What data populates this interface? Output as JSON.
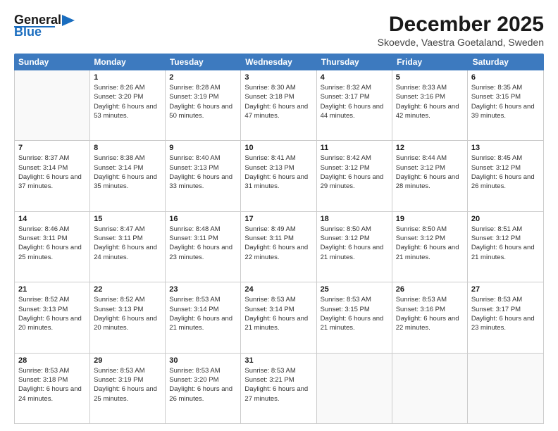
{
  "logo": {
    "line1": "General",
    "line2": "Blue"
  },
  "title": "December 2025",
  "subtitle": "Skoevde, Vaestra Goetaland, Sweden",
  "headers": [
    "Sunday",
    "Monday",
    "Tuesday",
    "Wednesday",
    "Thursday",
    "Friday",
    "Saturday"
  ],
  "weeks": [
    [
      {
        "day": "",
        "sunrise": "",
        "sunset": "",
        "daylight": ""
      },
      {
        "day": "1",
        "sunrise": "Sunrise: 8:26 AM",
        "sunset": "Sunset: 3:20 PM",
        "daylight": "Daylight: 6 hours and 53 minutes."
      },
      {
        "day": "2",
        "sunrise": "Sunrise: 8:28 AM",
        "sunset": "Sunset: 3:19 PM",
        "daylight": "Daylight: 6 hours and 50 minutes."
      },
      {
        "day": "3",
        "sunrise": "Sunrise: 8:30 AM",
        "sunset": "Sunset: 3:18 PM",
        "daylight": "Daylight: 6 hours and 47 minutes."
      },
      {
        "day": "4",
        "sunrise": "Sunrise: 8:32 AM",
        "sunset": "Sunset: 3:17 PM",
        "daylight": "Daylight: 6 hours and 44 minutes."
      },
      {
        "day": "5",
        "sunrise": "Sunrise: 8:33 AM",
        "sunset": "Sunset: 3:16 PM",
        "daylight": "Daylight: 6 hours and 42 minutes."
      },
      {
        "day": "6",
        "sunrise": "Sunrise: 8:35 AM",
        "sunset": "Sunset: 3:15 PM",
        "daylight": "Daylight: 6 hours and 39 minutes."
      }
    ],
    [
      {
        "day": "7",
        "sunrise": "Sunrise: 8:37 AM",
        "sunset": "Sunset: 3:14 PM",
        "daylight": "Daylight: 6 hours and 37 minutes."
      },
      {
        "day": "8",
        "sunrise": "Sunrise: 8:38 AM",
        "sunset": "Sunset: 3:14 PM",
        "daylight": "Daylight: 6 hours and 35 minutes."
      },
      {
        "day": "9",
        "sunrise": "Sunrise: 8:40 AM",
        "sunset": "Sunset: 3:13 PM",
        "daylight": "Daylight: 6 hours and 33 minutes."
      },
      {
        "day": "10",
        "sunrise": "Sunrise: 8:41 AM",
        "sunset": "Sunset: 3:13 PM",
        "daylight": "Daylight: 6 hours and 31 minutes."
      },
      {
        "day": "11",
        "sunrise": "Sunrise: 8:42 AM",
        "sunset": "Sunset: 3:12 PM",
        "daylight": "Daylight: 6 hours and 29 minutes."
      },
      {
        "day": "12",
        "sunrise": "Sunrise: 8:44 AM",
        "sunset": "Sunset: 3:12 PM",
        "daylight": "Daylight: 6 hours and 28 minutes."
      },
      {
        "day": "13",
        "sunrise": "Sunrise: 8:45 AM",
        "sunset": "Sunset: 3:12 PM",
        "daylight": "Daylight: 6 hours and 26 minutes."
      }
    ],
    [
      {
        "day": "14",
        "sunrise": "Sunrise: 8:46 AM",
        "sunset": "Sunset: 3:11 PM",
        "daylight": "Daylight: 6 hours and 25 minutes."
      },
      {
        "day": "15",
        "sunrise": "Sunrise: 8:47 AM",
        "sunset": "Sunset: 3:11 PM",
        "daylight": "Daylight: 6 hours and 24 minutes."
      },
      {
        "day": "16",
        "sunrise": "Sunrise: 8:48 AM",
        "sunset": "Sunset: 3:11 PM",
        "daylight": "Daylight: 6 hours and 23 minutes."
      },
      {
        "day": "17",
        "sunrise": "Sunrise: 8:49 AM",
        "sunset": "Sunset: 3:11 PM",
        "daylight": "Daylight: 6 hours and 22 minutes."
      },
      {
        "day": "18",
        "sunrise": "Sunrise: 8:50 AM",
        "sunset": "Sunset: 3:12 PM",
        "daylight": "Daylight: 6 hours and 21 minutes."
      },
      {
        "day": "19",
        "sunrise": "Sunrise: 8:50 AM",
        "sunset": "Sunset: 3:12 PM",
        "daylight": "Daylight: 6 hours and 21 minutes."
      },
      {
        "day": "20",
        "sunrise": "Sunrise: 8:51 AM",
        "sunset": "Sunset: 3:12 PM",
        "daylight": "Daylight: 6 hours and 21 minutes."
      }
    ],
    [
      {
        "day": "21",
        "sunrise": "Sunrise: 8:52 AM",
        "sunset": "Sunset: 3:13 PM",
        "daylight": "Daylight: 6 hours and 20 minutes."
      },
      {
        "day": "22",
        "sunrise": "Sunrise: 8:52 AM",
        "sunset": "Sunset: 3:13 PM",
        "daylight": "Daylight: 6 hours and 20 minutes."
      },
      {
        "day": "23",
        "sunrise": "Sunrise: 8:53 AM",
        "sunset": "Sunset: 3:14 PM",
        "daylight": "Daylight: 6 hours and 21 minutes."
      },
      {
        "day": "24",
        "sunrise": "Sunrise: 8:53 AM",
        "sunset": "Sunset: 3:14 PM",
        "daylight": "Daylight: 6 hours and 21 minutes."
      },
      {
        "day": "25",
        "sunrise": "Sunrise: 8:53 AM",
        "sunset": "Sunset: 3:15 PM",
        "daylight": "Daylight: 6 hours and 21 minutes."
      },
      {
        "day": "26",
        "sunrise": "Sunrise: 8:53 AM",
        "sunset": "Sunset: 3:16 PM",
        "daylight": "Daylight: 6 hours and 22 minutes."
      },
      {
        "day": "27",
        "sunrise": "Sunrise: 8:53 AM",
        "sunset": "Sunset: 3:17 PM",
        "daylight": "Daylight: 6 hours and 23 minutes."
      }
    ],
    [
      {
        "day": "28",
        "sunrise": "Sunrise: 8:53 AM",
        "sunset": "Sunset: 3:18 PM",
        "daylight": "Daylight: 6 hours and 24 minutes."
      },
      {
        "day": "29",
        "sunrise": "Sunrise: 8:53 AM",
        "sunset": "Sunset: 3:19 PM",
        "daylight": "Daylight: 6 hours and 25 minutes."
      },
      {
        "day": "30",
        "sunrise": "Sunrise: 8:53 AM",
        "sunset": "Sunset: 3:20 PM",
        "daylight": "Daylight: 6 hours and 26 minutes."
      },
      {
        "day": "31",
        "sunrise": "Sunrise: 8:53 AM",
        "sunset": "Sunset: 3:21 PM",
        "daylight": "Daylight: 6 hours and 27 minutes."
      },
      {
        "day": "",
        "sunrise": "",
        "sunset": "",
        "daylight": ""
      },
      {
        "day": "",
        "sunrise": "",
        "sunset": "",
        "daylight": ""
      },
      {
        "day": "",
        "sunrise": "",
        "sunset": "",
        "daylight": ""
      }
    ]
  ]
}
